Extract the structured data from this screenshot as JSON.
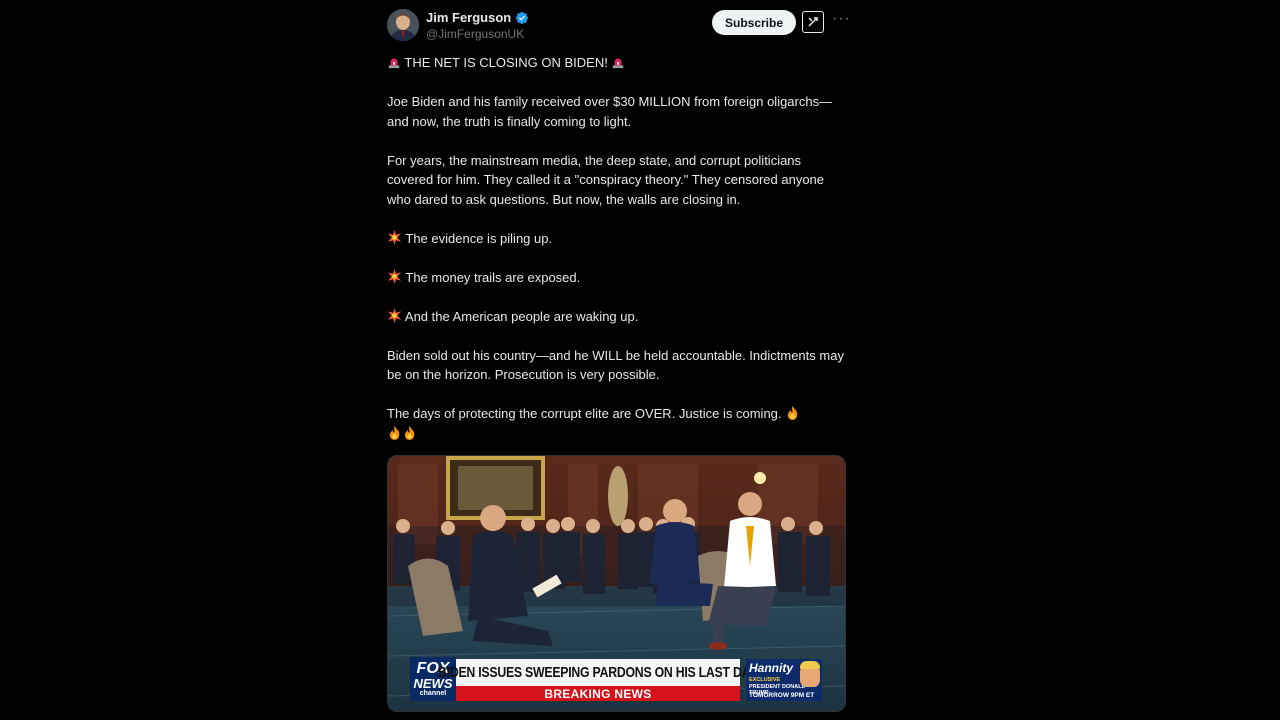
{
  "author": {
    "name": "Jim Ferguson",
    "handle": "@JimFergusonUK",
    "verified": true
  },
  "actions": {
    "subscribe_label": "Subscribe",
    "grok_icon": "grok-icon",
    "more_icon": "more-icon",
    "more_label": "···"
  },
  "post": {
    "headline": "THE NET IS CLOSING ON BIDEN!",
    "paragraphs": [
      "Joe Biden and his family received over $30 MILLION from foreign oligarchs—and now, the truth is finally coming to light.",
      "For years, the mainstream media, the deep state, and corrupt politicians covered for him. They called it a \"conspiracy theory.\" They censored anyone who dared to ask questions. But now, the walls are closing in.",
      "The evidence is piling up.",
      "The money trails are exposed.",
      "And the American people are waking up.",
      "Biden sold out his country—and he WILL be held accountable. Indictments may be on the horizon. Prosecution is very possible.",
      "The days of protecting the corrupt elite are OVER. Justice is coming."
    ]
  },
  "media": {
    "network_logo": [
      "FOX",
      "NEWS",
      "channel"
    ],
    "chyron_headline": "BIDEN ISSUES SWEEPING PARDONS ON HIS LAST DAY",
    "chyron_banner": "BREAKING NEWS",
    "promo_title": "Hannity",
    "promo_line1": "EXCLUSIVE",
    "promo_line2": "PRESIDENT DONALD TRUMP",
    "promo_time": "TOMORROW 9PM ET"
  },
  "colors": {
    "background": "#000000",
    "text": "#e7e9ea",
    "muted": "#71767b",
    "verified_badge": "#1d9bf0",
    "breaking_red": "#d3121a",
    "fox_blue": "#0a2a66"
  }
}
